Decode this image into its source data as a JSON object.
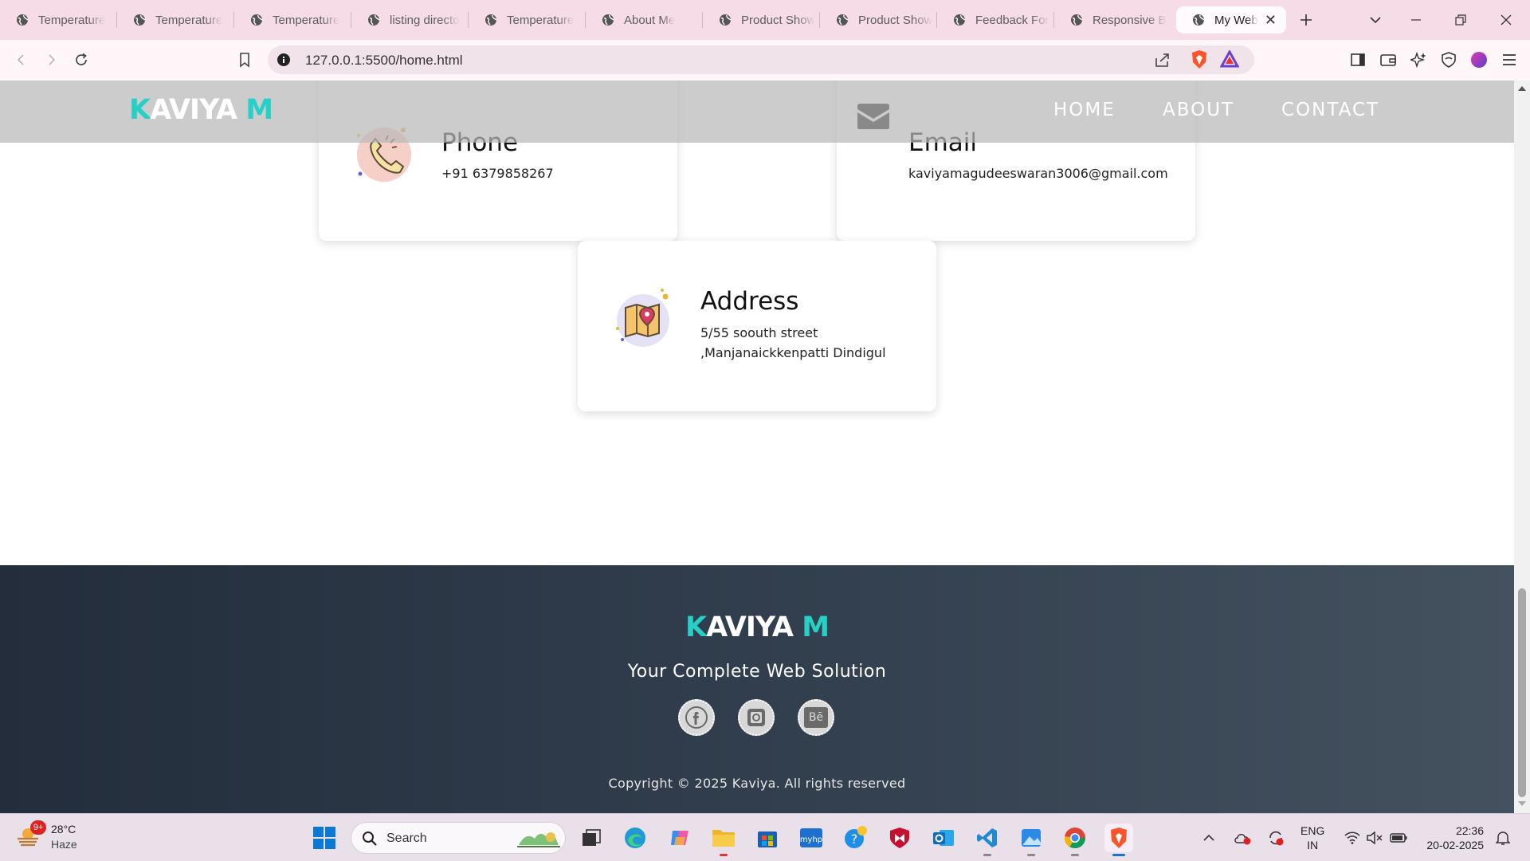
{
  "browser": {
    "tabs": [
      {
        "label": "Temperature",
        "active": false
      },
      {
        "label": "Temperature",
        "active": false
      },
      {
        "label": "Temperature",
        "active": false
      },
      {
        "label": "listing directo",
        "active": false
      },
      {
        "label": "Temperature",
        "active": false
      },
      {
        "label": "About Me",
        "active": false
      },
      {
        "label": "Product Show",
        "active": false
      },
      {
        "label": "Product Show",
        "active": false
      },
      {
        "label": "Feedback For",
        "active": false
      },
      {
        "label": "Responsive B",
        "active": false
      },
      {
        "label": "My Web",
        "active": true
      }
    ],
    "url": "127.0.0.1:5500/home.html"
  },
  "site": {
    "logo_first": "K",
    "logo_middle": "AVIYA ",
    "logo_last": "M",
    "nav": [
      "HOME",
      "ABOUT",
      "CONTACT"
    ],
    "contact": {
      "phone": {
        "title": "Phone",
        "value": "+91 6379858267"
      },
      "email": {
        "title": "Email",
        "value": "kaviyamagudeeswaran3006@gmail.com"
      },
      "address": {
        "title": "Address",
        "line1": "5/55 soouth street",
        "line2": ",Manjanaickkenpatti Dindigul"
      }
    },
    "footer": {
      "tagline": "Your Complete Web Solution",
      "social": [
        "facebook-icon",
        "instagram-icon",
        "behance-icon"
      ],
      "behance_text": "Bē",
      "copyright": "Copyright © 2025 Kaviya. All rights reserved"
    },
    "colors": {
      "accent": "#26d0c7",
      "footer_bg": "#2c3746",
      "nav_overlay": "#b9b9b9"
    }
  },
  "taskbar": {
    "weather_temp": "28°C",
    "weather_desc": "Haze",
    "weather_badge": "9+",
    "search_placeholder": "Search",
    "lang_line1": "ENG",
    "lang_line2": "IN",
    "time": "22:36",
    "date": "20-02-2025"
  }
}
